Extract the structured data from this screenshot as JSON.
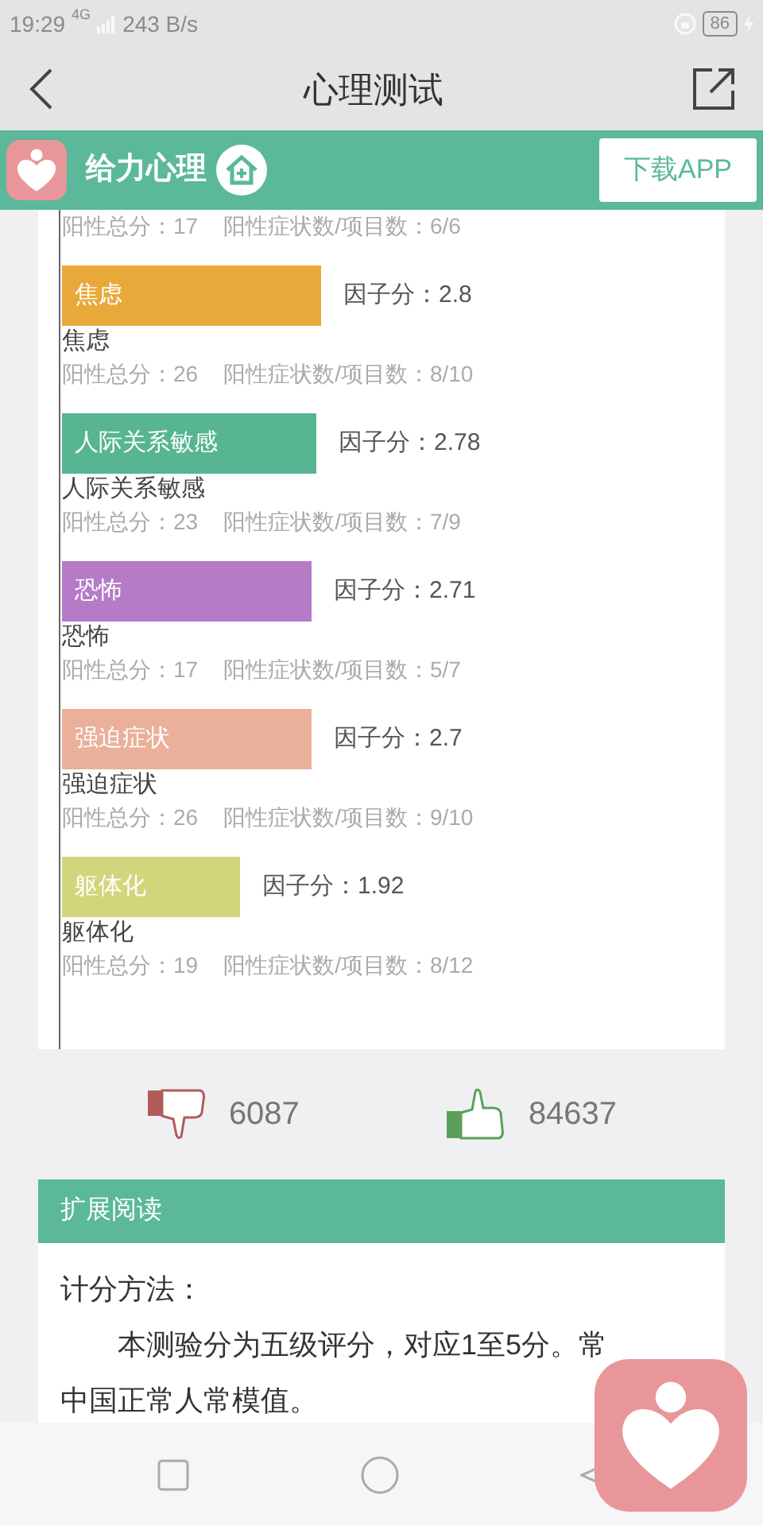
{
  "status_bar": {
    "time": "19:29",
    "network": "4G",
    "speed": "243 B/s",
    "battery": "86"
  },
  "nav_bar": {
    "title": "心理测试"
  },
  "banner": {
    "app_name": "给力心理",
    "download_button": "下载APP"
  },
  "partial_row": {
    "total": "阳性总分：17",
    "ratio": "阳性症状数/项目数：6/6"
  },
  "factors": [
    {
      "bar_label": "焦虑",
      "score": "因子分：2.8",
      "color": "#e9a93a",
      "caption": "焦虑",
      "total": "阳性总分：26",
      "ratio": "阳性症状数/项目数：8/10"
    },
    {
      "bar_label": "人际关系敏感",
      "score": "因子分：2.78",
      "color": "#57b591",
      "caption": "人际关系敏感",
      "total": "阳性总分：23",
      "ratio": "阳性症状数/项目数：7/9"
    },
    {
      "bar_label": "恐怖",
      "score": "因子分：2.71",
      "color": "#b67bc6",
      "caption": "恐怖",
      "total": "阳性总分：17",
      "ratio": "阳性症状数/项目数：5/7"
    },
    {
      "bar_label": "强迫症状",
      "score": "因子分：2.7",
      "color": "#eab09a",
      "caption": "强迫症状",
      "total": "阳性总分：26",
      "ratio": "阳性症状数/项目数：9/10"
    },
    {
      "bar_label": "躯体化",
      "score": "因子分：1.92",
      "color": "#d3d57c",
      "caption": "躯体化",
      "total": "阳性总分：19",
      "ratio": "阳性症状数/项目数：8/12"
    }
  ],
  "votes": {
    "dislikes": "6087",
    "likes": "84637"
  },
  "reading": {
    "header": "扩展阅读",
    "heading": "计分方法：",
    "paragraph_line_1": "本测验分为五级评分，对应1至5分。常",
    "paragraph_line_2": "中国正常人常模值。"
  }
}
